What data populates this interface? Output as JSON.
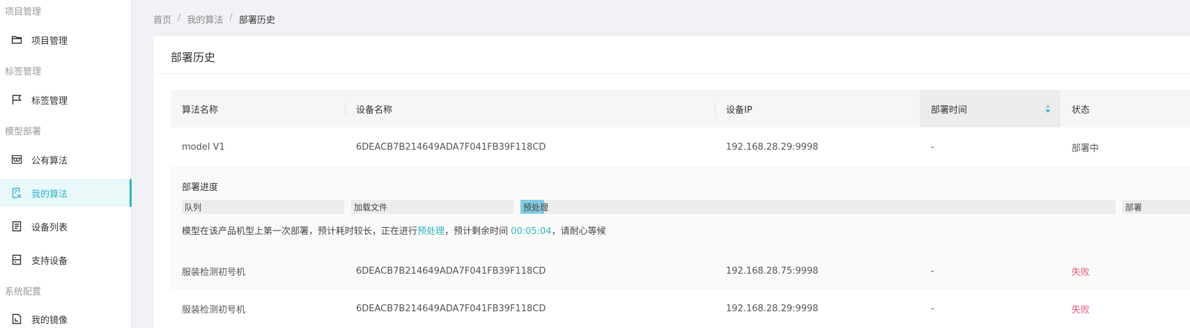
{
  "sidebar": {
    "groups": [
      {
        "title": "项目管理",
        "items": [
          {
            "label": "项目管理",
            "icon": "folder-icon"
          }
        ]
      },
      {
        "title": "标签管理",
        "items": [
          {
            "label": "标签管理",
            "icon": "flag-icon"
          }
        ]
      },
      {
        "title": "模型部署",
        "items": [
          {
            "label": "公有算法",
            "icon": "store-icon"
          },
          {
            "label": "我的算法",
            "icon": "my-algorithm-icon",
            "active": true
          },
          {
            "label": "设备列表",
            "icon": "device-list-icon"
          },
          {
            "label": "支持设备",
            "icon": "server-icon"
          }
        ]
      },
      {
        "title": "系统配置",
        "items": [
          {
            "label": "我的镜像",
            "icon": "image-doc-icon"
          }
        ]
      }
    ]
  },
  "breadcrumb": {
    "home": "首页",
    "sep1": "/",
    "parent": "我的算法",
    "sep2": "/",
    "current": "部署历史"
  },
  "card": {
    "title": "部署历史"
  },
  "table": {
    "headers": {
      "name": "算法名称",
      "device": "设备名称",
      "ip": "设备IP",
      "time": "部署时间",
      "status": "状态"
    },
    "rows": [
      {
        "name": "model V1",
        "device": "6DEACB7B214649ADA7F041FB39F118CD",
        "ip": "192.168.28.29:9998",
        "time": "-",
        "status": "部署中"
      },
      {
        "name": "服装检测初号机",
        "device": "6DEACB7B214649ADA7F041FB39F118CD",
        "ip": "192.168.28.75:9998",
        "time": "-",
        "status": "失败"
      },
      {
        "name": "服装检测初号机",
        "device": "6DEACB7B214649ADA7F041FB39F118CD",
        "ip": "192.168.28.29:9998",
        "time": "-",
        "status": "失败"
      }
    ]
  },
  "progress": {
    "title": "部署进度",
    "stages": [
      "队列",
      "加载文件",
      "预处理",
      "部署"
    ],
    "current_stage_fill": 0.04,
    "msg_prefix": "模型在该产品机型上第一次部署，预计耗时较长，正在进行",
    "msg_stage": "预处理",
    "msg_mid": "，预计剩余时间 ",
    "msg_time": "00:05:04",
    "msg_suffix": "，请耐心等候"
  },
  "colors": {
    "accent": "#2bb6c9",
    "error": "#f0567a",
    "progress_fill": "#7fcbe0"
  }
}
